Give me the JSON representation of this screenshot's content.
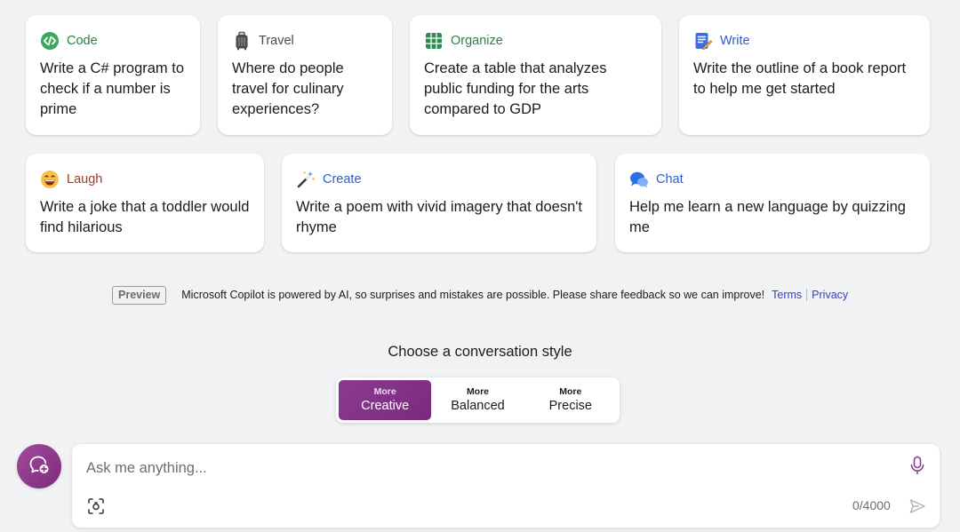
{
  "suggestions_row1": [
    {
      "icon": "code-icon",
      "category": "Code",
      "category_color": "#2d7d46",
      "text": "Write a C# program to check if a number is prime"
    },
    {
      "icon": "luggage-icon",
      "category": "Travel",
      "category_color": "#4a4a4a",
      "text": "Where do people travel for culinary experiences?"
    },
    {
      "icon": "grid-icon",
      "category": "Organize",
      "category_color": "#2d7d46",
      "text": "Create a table that analyzes public funding for the arts compared to GDP"
    },
    {
      "icon": "pencil-notepad-icon",
      "category": "Write",
      "category_color": "#2b5ed3",
      "text": "Write the outline of a book report to help me get started"
    }
  ],
  "suggestions_row2": [
    {
      "icon": "grinning-face-icon",
      "category": "Laugh",
      "category_color": "#9a3d20",
      "text": "Write a joke that a toddler would find hilarious"
    },
    {
      "icon": "magic-wand-icon",
      "category": "Create",
      "category_color": "#2b5ed3",
      "text": "Write a poem with vivid imagery that doesn't rhyme"
    },
    {
      "icon": "speech-bubbles-icon",
      "category": "Chat",
      "category_color": "#2b5ed3",
      "text": "Help me learn a new language by quizzing me"
    }
  ],
  "disclaimer": {
    "badge": "Preview",
    "text": "Microsoft Copilot is powered by AI, so surprises and mistakes are possible. Please share feedback so we can improve!",
    "terms_label": "Terms",
    "privacy_label": "Privacy"
  },
  "conversation_style": {
    "title": "Choose a conversation style",
    "selected": "Creative",
    "options": [
      {
        "small": "More",
        "label": "Creative"
      },
      {
        "small": "More",
        "label": "Balanced"
      },
      {
        "small": "More",
        "label": "Precise"
      }
    ]
  },
  "composer": {
    "placeholder": "Ask me anything...",
    "char_count": "0/4000"
  },
  "colors": {
    "accent": "#7f2f82",
    "link": "#3b3fb6",
    "background": "#f1f2f4"
  }
}
